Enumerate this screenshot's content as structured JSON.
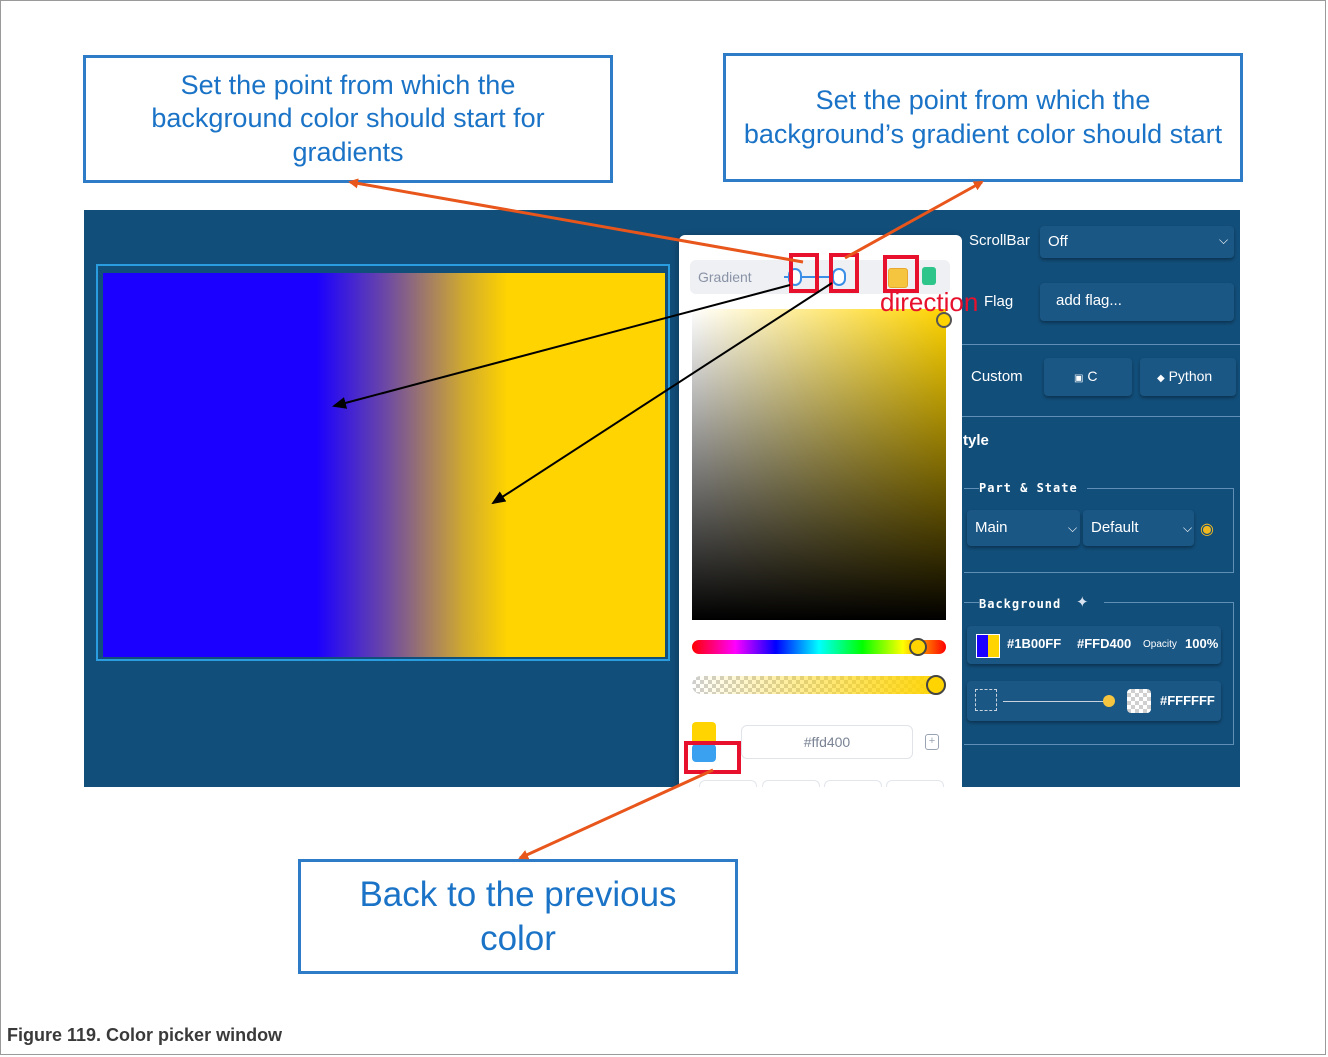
{
  "callouts": {
    "bg_start": "Set the point from which the background color should start for gradients",
    "grad_start": "Set the point from which the background’s gradient color should start",
    "back_prev": "Back to the previous color"
  },
  "direction_label": "direction",
  "picker": {
    "gradient_label": "Gradient",
    "hex_value": "#ffd400",
    "current_color": "#ffd400",
    "previous_color": "#3aa0f0"
  },
  "properties": {
    "scrollbar_label": "ScrollBar",
    "scrollbar_value": "Off",
    "flag_label": "Flag",
    "flag_placeholder": "add flag...",
    "custom_label": "Custom",
    "custom_c": "C",
    "custom_python": "Python",
    "style_heading": "tyle",
    "part_state_title": "Part & State",
    "part_value": "Main",
    "state_value": "Default",
    "background_title": "Background",
    "bg_color1": "#1B00FF",
    "bg_color2": "#FFD400",
    "opacity_label": "Opacity",
    "opacity_value": "100%",
    "bg_image_color": "#FFFFFF"
  },
  "canvas": {
    "gradient_start_color": "#1B00FF",
    "gradient_end_color": "#FFD400"
  },
  "caption": "Figure 119.  Color picker window"
}
